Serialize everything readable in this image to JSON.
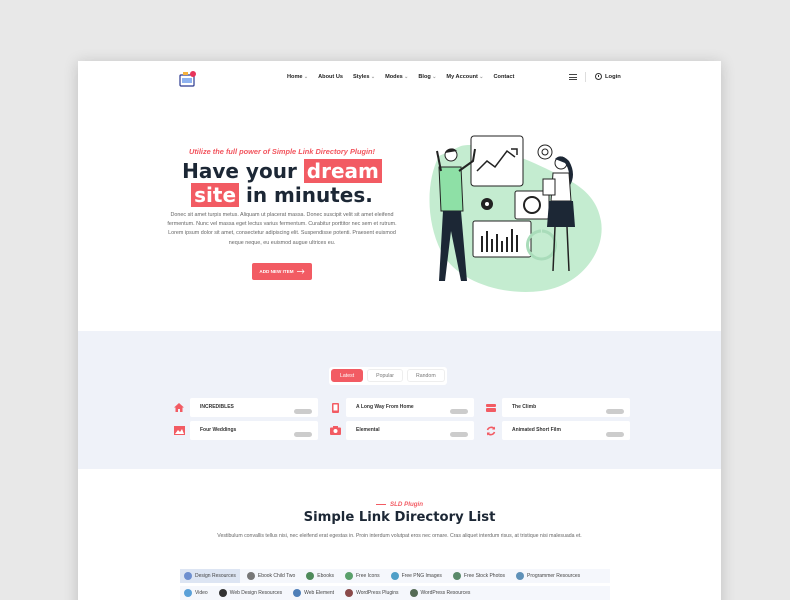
{
  "nav": {
    "items": [
      {
        "label": "Home",
        "dropdown": true
      },
      {
        "label": "About Us",
        "dropdown": false
      },
      {
        "label": "Styles",
        "dropdown": true
      },
      {
        "label": "Modes",
        "dropdown": true
      },
      {
        "label": "Blog",
        "dropdown": true
      },
      {
        "label": "My Account",
        "dropdown": true
      },
      {
        "label": "Contact",
        "dropdown": false
      }
    ],
    "login_label": "Login"
  },
  "hero": {
    "tagline": "Utilize the full power of Simple Link Directory Plugin!",
    "title_part1": "Have your ",
    "title_highlight1": "dream",
    "title_highlight2": "site",
    "title_part2": " in minutes.",
    "text": "Donec sit amet turpis metus. Aliquam ut placerat massa. Donec suscipit velit sit amet eleifend fermentum. Nunc vel massa eget lectus varius fermentum. Curabitur porttitor nec sem et rutrum. Lorem ipsum dolor sit amet, consectetur adipiscing elit. Suspendisse potenti. Praesent euismod neque neque, eu euismod augue ultrices eu.",
    "button_label": "ADD NEW ITEM"
  },
  "items_section": {
    "tabs": [
      "Latest",
      "Popular",
      "Random"
    ],
    "active_tab": "Latest",
    "items": [
      {
        "label": "INCREDIBLES",
        "icon": "home-icon"
      },
      {
        "label": "A Long Way From Home",
        "icon": "mobile-icon"
      },
      {
        "label": "The Climb",
        "icon": "drive-icon"
      },
      {
        "label": "Four Weddings",
        "icon": "image-icon"
      },
      {
        "label": "Elemental",
        "icon": "camera-icon"
      },
      {
        "label": "Animated Short Film",
        "icon": "refresh-icon"
      }
    ]
  },
  "directory": {
    "tag": "SLD Plugin",
    "title": "Simple Link Directory List",
    "text": "Vestibulum convallis tellus nisi, nec eleifend erat egestas in. Proin interdum volutpat eros nec ornare. Cras aliquet interdum risus, at tristique nisi malesuada et.",
    "categories_row1": [
      "Design Resources",
      "Ebook Child Two",
      "Ebooks",
      "Free Icons",
      "Free PNG Images",
      "Free Stock Photos",
      "Programmer Resources"
    ],
    "categories_row2": [
      "Video",
      "Web Design Resources",
      "Web Element",
      "WordPress Plugins",
      "WordPress Resources"
    ],
    "active_category": "Design Resources"
  },
  "colors": {
    "accent": "#f25b63",
    "dark": "#1c2735",
    "section_bg": "#eff2f9",
    "illustration_green": "#c4ecd0"
  }
}
